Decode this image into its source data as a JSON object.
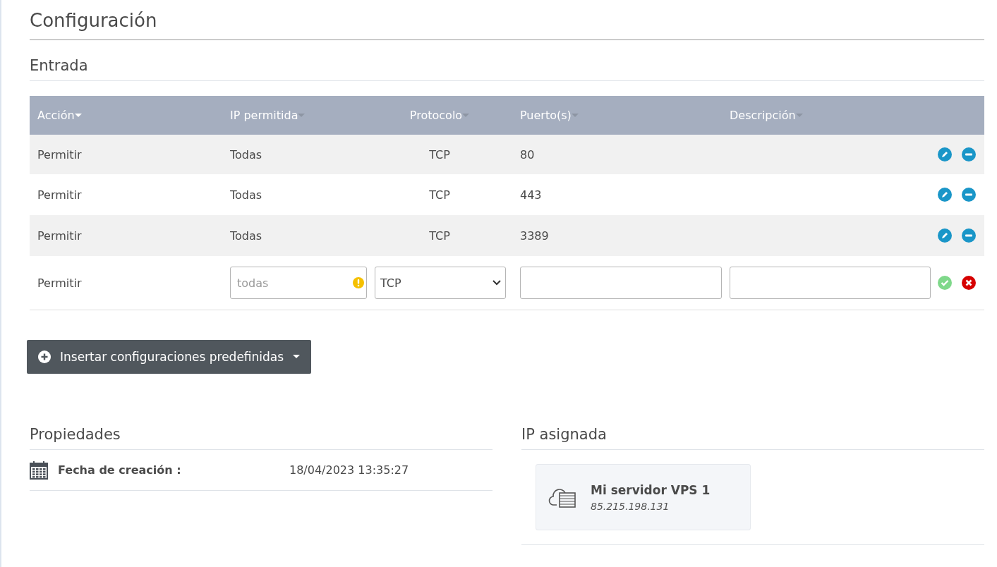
{
  "title": "Configuración",
  "section": "Entrada",
  "table": {
    "columns": [
      {
        "label": "Acción",
        "sorted": true
      },
      {
        "label": "IP permitida",
        "sorted": false
      },
      {
        "label": "Protocolo",
        "sorted": false
      },
      {
        "label": "Puerto(s)",
        "sorted": false
      },
      {
        "label": "Descripción",
        "sorted": false
      }
    ],
    "rows": [
      {
        "action": "Permitir",
        "ip": "Todas",
        "protocol": "TCP",
        "ports": "80"
      },
      {
        "action": "Permitir",
        "ip": "Todas",
        "protocol": "TCP",
        "ports": "443"
      },
      {
        "action": "Permitir",
        "ip": "Todas",
        "protocol": "TCP",
        "ports": "3389"
      }
    ],
    "new_row": {
      "action": "Permitir",
      "ip_placeholder": "todas",
      "ip_warning": true,
      "protocol": "TCP"
    }
  },
  "preset_button": "Insertar configuraciones predefinidas",
  "properties": {
    "title": "Propiedades",
    "items": [
      {
        "label": "Fecha de creación :",
        "value": "18/04/2023 13:35:27"
      }
    ]
  },
  "assigned_ip": {
    "title": "IP asignada",
    "server": {
      "name": "Mi servidor VPS 1",
      "ip": "85.215.198.131"
    }
  }
}
